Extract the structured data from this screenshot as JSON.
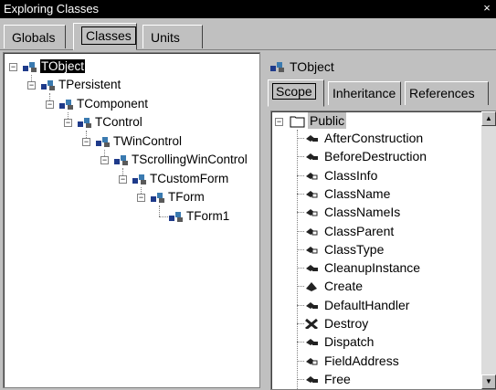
{
  "window": {
    "title": "Exploring Classes",
    "close": "×"
  },
  "tabs": [
    "Globals",
    "Classes",
    "Units"
  ],
  "active_tab": "Classes",
  "tree": [
    {
      "label": "TObject",
      "selected": true
    },
    {
      "label": "TPersistent"
    },
    {
      "label": "TComponent"
    },
    {
      "label": "TControl"
    },
    {
      "label": "TWinControl"
    },
    {
      "label": "TScrollingWinControl"
    },
    {
      "label": "TCustomForm"
    },
    {
      "label": "TForm"
    },
    {
      "label": "TForm1"
    }
  ],
  "detail": {
    "header": "TObject",
    "tabs": [
      "Scope",
      "Inheritance",
      "References"
    ],
    "active_tab": "Scope",
    "folder": "Public",
    "members": [
      {
        "name": "AfterConstruction",
        "icon": "method-icon"
      },
      {
        "name": "BeforeDestruction",
        "icon": "method-icon"
      },
      {
        "name": "ClassInfo",
        "icon": "function-icon"
      },
      {
        "name": "ClassName",
        "icon": "function-icon"
      },
      {
        "name": "ClassNameIs",
        "icon": "function-icon"
      },
      {
        "name": "ClassParent",
        "icon": "function-icon"
      },
      {
        "name": "ClassType",
        "icon": "function-icon"
      },
      {
        "name": "CleanupInstance",
        "icon": "method-icon"
      },
      {
        "name": "Create",
        "icon": "constructor-icon"
      },
      {
        "name": "DefaultHandler",
        "icon": "method-icon"
      },
      {
        "name": "Destroy",
        "icon": "destructor-icon"
      },
      {
        "name": "Dispatch",
        "icon": "method-icon"
      },
      {
        "name": "FieldAddress",
        "icon": "function-icon"
      },
      {
        "name": "Free",
        "icon": "method-icon"
      }
    ]
  },
  "colors": {
    "window_bg": "#c0c0c0",
    "title_bg": "#000000",
    "selection": "#000000",
    "folder_fill": "#ffffff"
  }
}
